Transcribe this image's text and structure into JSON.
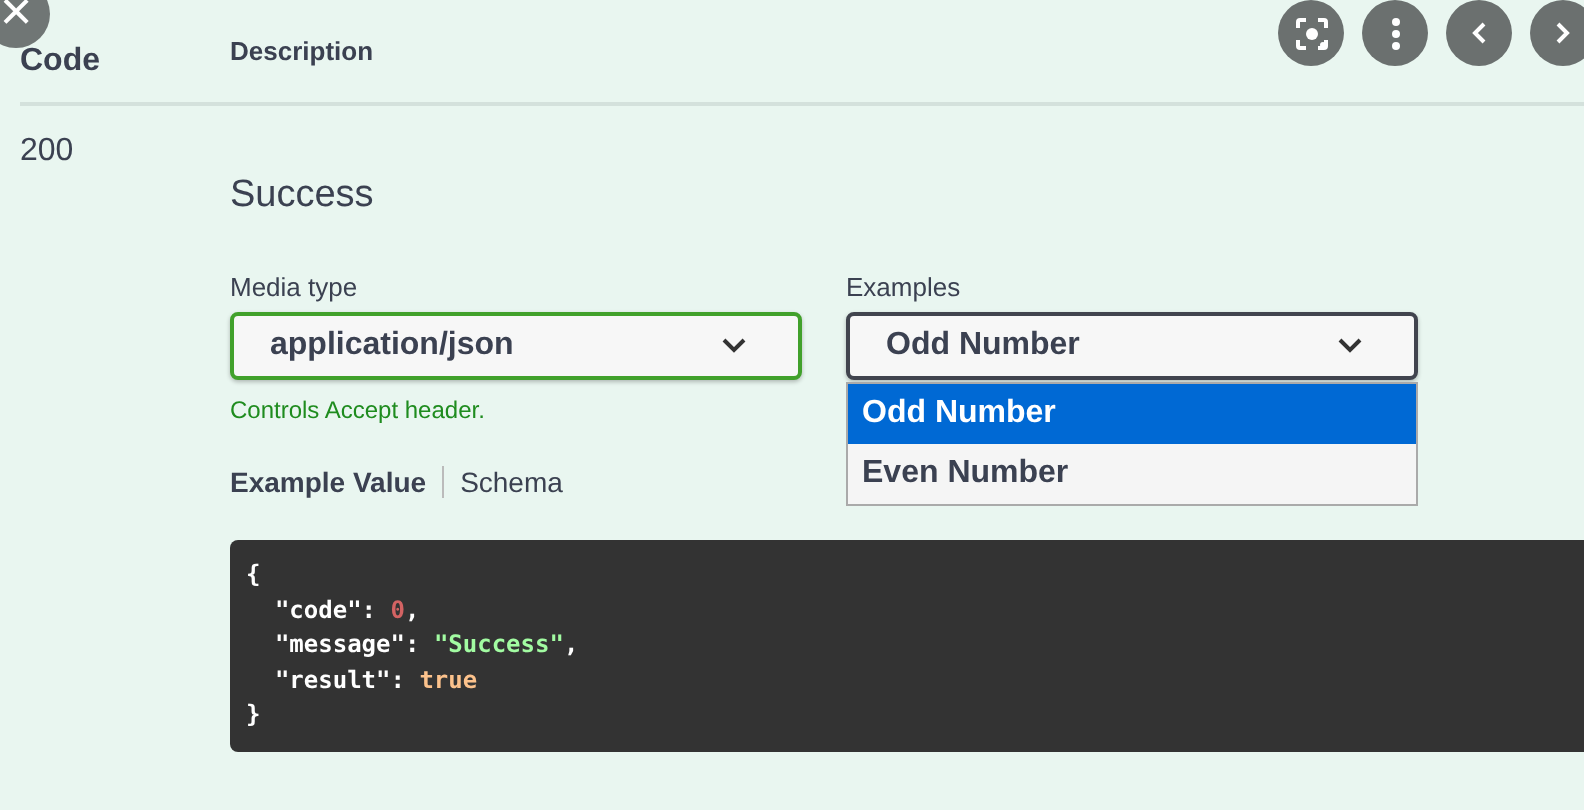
{
  "viewer_controls": {
    "close": "×",
    "buttons": [
      {
        "kind": "lens"
      },
      {
        "kind": "more"
      },
      {
        "kind": "prev"
      },
      {
        "kind": "next"
      }
    ]
  },
  "table": {
    "columns": [
      "Code",
      "Description"
    ],
    "rows": [
      {
        "code": "200",
        "description": "Success",
        "media_type": {
          "label": "Media type",
          "value": "application/json",
          "hint": "Controls Accept header."
        },
        "examples": {
          "label": "Examples",
          "value": "Odd Number",
          "expanded": true,
          "options": [
            {
              "label": "Odd Number",
              "selected": true
            },
            {
              "label": "Even Number",
              "selected": false
            }
          ]
        },
        "tabs": [
          {
            "label": "Example Value",
            "selected": true
          },
          {
            "label": "Schema",
            "selected": false
          }
        ],
        "example_code": [
          [
            {
              "kind": "punct",
              "text": "{"
            }
          ],
          [
            {
              "kind": "key",
              "text": "  \"code\""
            },
            {
              "kind": "punct",
              "text": ": "
            },
            {
              "kind": "number",
              "text": "0"
            },
            {
              "kind": "punct",
              "text": ","
            }
          ],
          [
            {
              "kind": "key",
              "text": "  \"message\""
            },
            {
              "kind": "punct",
              "text": ": "
            },
            {
              "kind": "string",
              "text": "\"Success\""
            },
            {
              "kind": "punct",
              "text": ","
            }
          ],
          [
            {
              "kind": "key",
              "text": "  \"result\""
            },
            {
              "kind": "punct",
              "text": ": "
            },
            {
              "kind": "boolean",
              "text": "true"
            }
          ],
          [
            {
              "kind": "punct",
              "text": "}"
            }
          ]
        ]
      }
    ]
  }
}
